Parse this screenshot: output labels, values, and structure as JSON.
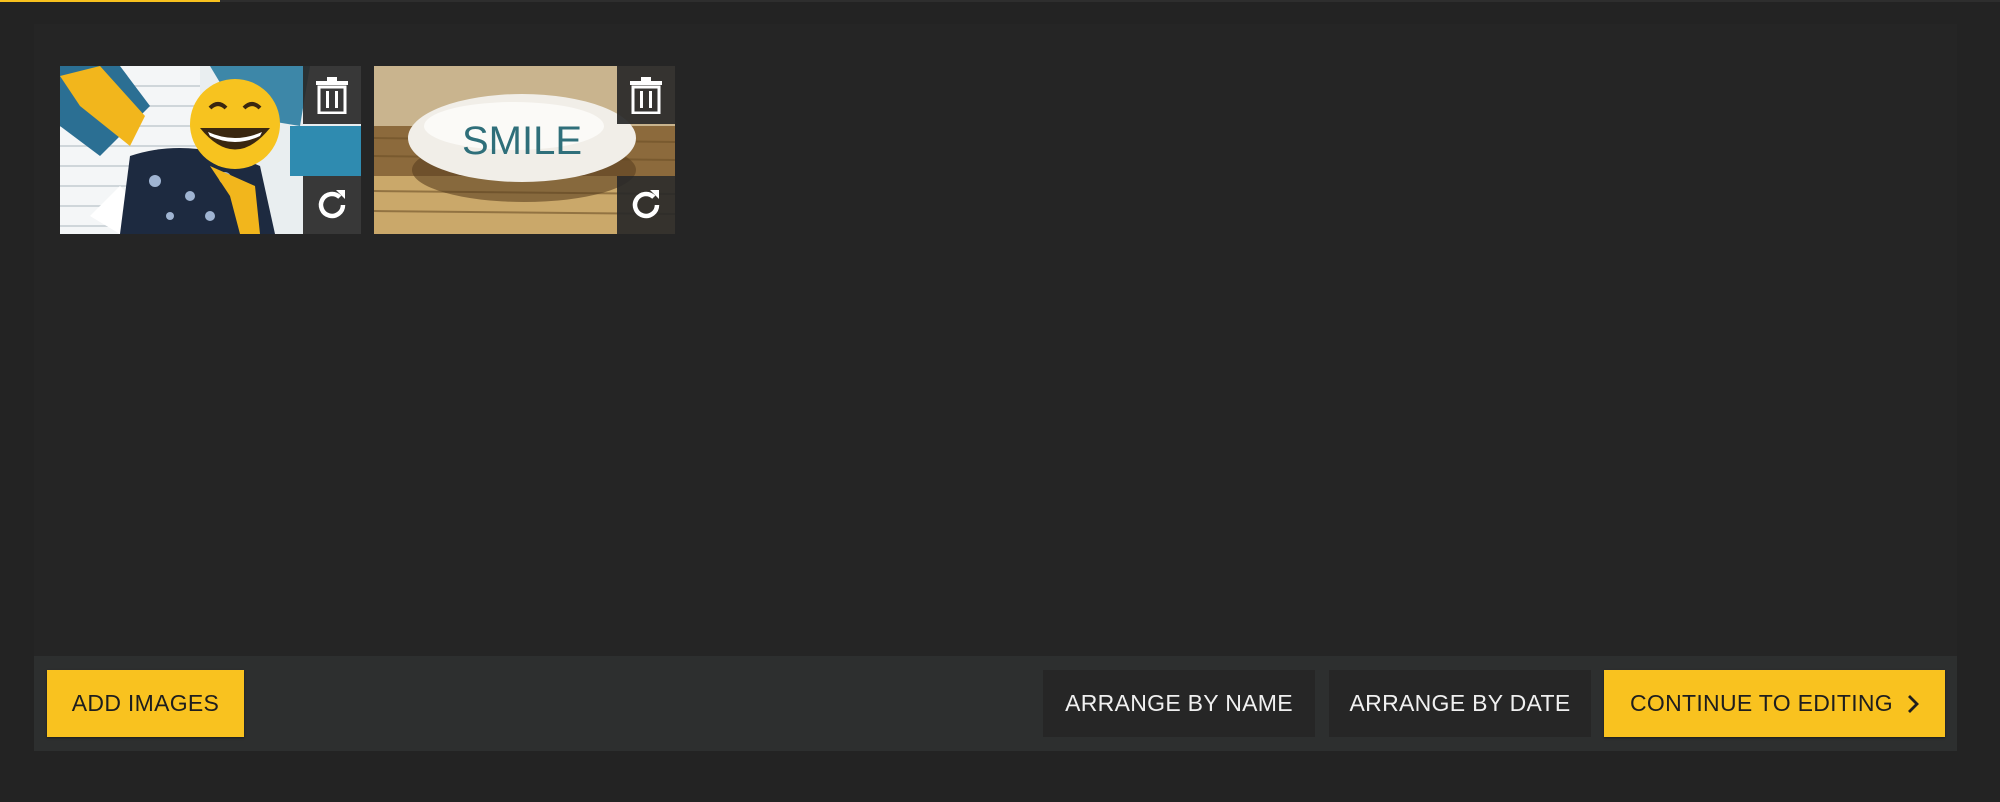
{
  "progress": {
    "fraction": 0.11
  },
  "thumbnails": [
    {
      "name": "emoji-face-photo",
      "delete_icon": "trash-icon",
      "rotate_icon": "rotate-icon"
    },
    {
      "name": "smile-stone-photo",
      "delete_icon": "trash-icon",
      "rotate_icon": "rotate-icon",
      "stone_text": "SMILE"
    }
  ],
  "toolbar": {
    "add_images": "ADD IMAGES",
    "arrange_by_name": "ARRANGE BY NAME",
    "arrange_by_date": "ARRANGE BY DATE",
    "continue_to_editing": "CONTINUE TO EDITING",
    "continue_icon": "chevron-right-icon"
  },
  "colors": {
    "accent": "#f9c21f",
    "background": "#232323",
    "toolbar": "#2d2f2f",
    "secondary_button": "#262626"
  }
}
